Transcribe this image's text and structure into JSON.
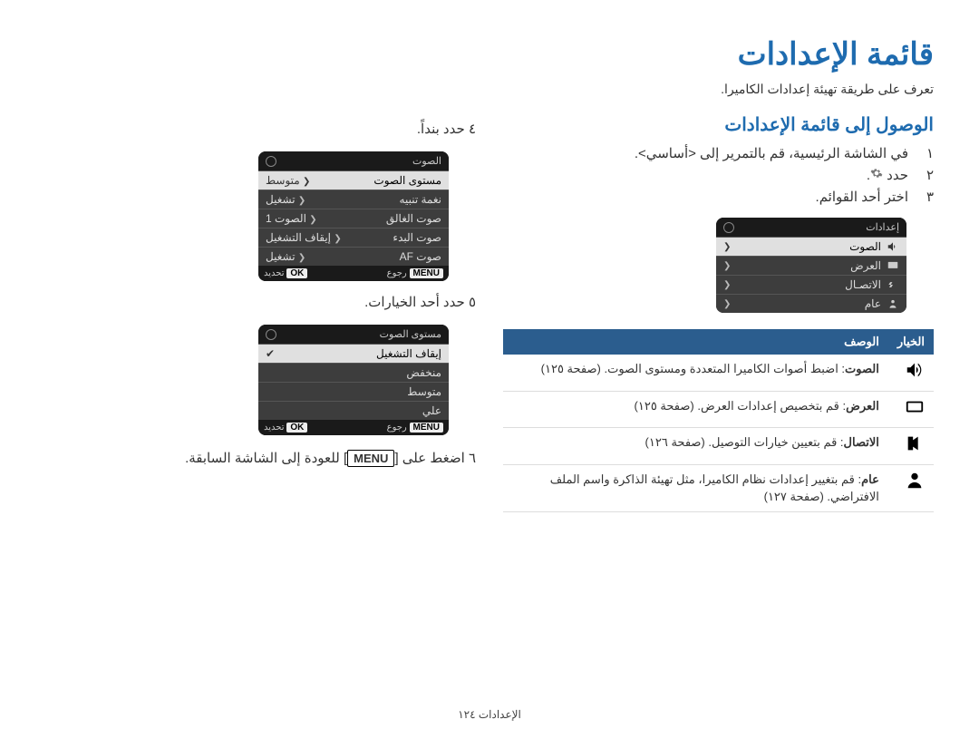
{
  "page_title": "قائمة الإعدادات",
  "subtitle": "تعرف على طريقة تهيئة إعدادات الكاميرا.",
  "section_heading": "الوصول إلى قائمة الإعدادات",
  "steps_right": {
    "s1": "١",
    "s1_text": "في الشاشة الرئيسية، قم بالتمرير إلى <أساسي>.",
    "s2": "٢",
    "s2_text": "حدد",
    "s3": "٣",
    "s3_text": "اختر أحد القوائم."
  },
  "cam1": {
    "header": "إعدادات",
    "row_sound": "الصوت",
    "row_display": "العرض",
    "row_conn": "الاتصـال",
    "row_general": "عام"
  },
  "option_table": {
    "header_option": "الخيار",
    "header_desc": "الوصف",
    "sound_label": "الصوت",
    "sound_desc": ": اضبط أصوات الكاميرا المتعددة ومستوى الصوت. (صفحة ١٢٥)",
    "display_label": "العرض",
    "display_desc": ": قم بتخصيص إعدادات العرض. (صفحة ١٢٥)",
    "conn_label": "الاتصال",
    "conn_desc": ": قم بتعيين خيارات التوصيل. (صفحة ١٢٦)",
    "general_label": "عام",
    "general_desc": ": قم بتغيير إعدادات نظام الكاميرا، مثل تهيئة الذاكرة واسم الملف الافتراضي. (صفحة ١٢٧)"
  },
  "steps_left": {
    "s4": "٤",
    "s4_text": "حدد بنداً.",
    "s5": "٥",
    "s5_text": "حدد أحد الخيارات.",
    "s6": "٦",
    "s6_text_before": "اضغط على [",
    "s6_menu": "MENU",
    "s6_text_after": "] للعودة إلى الشاشة السابقة."
  },
  "cam_sound": {
    "header": "الصوت",
    "vol_label": "مستوى الصوت",
    "vol_val": "متوسط",
    "beep_label": "نغمة تنبيه",
    "beep_val": "تشغيل",
    "shutter_label": "صوت الغالق",
    "shutter_val": "الصوت 1",
    "start_label": "صوت البدء",
    "start_val": "إيقاف التشغيل",
    "af_label": "صوت AF",
    "af_val": "تشغيل",
    "footer_back": "رجوع",
    "footer_set": "تحديد",
    "menu_key": "MENU",
    "ok_key": "OK"
  },
  "cam_volume": {
    "header": "مستوى الصوت",
    "off": "إيقاف التشغيل",
    "low": "منخفض",
    "medium": "متوسط",
    "high": "علي",
    "footer_back": "رجوع",
    "footer_set": "تحديد",
    "menu_key": "MENU",
    "ok_key": "OK"
  },
  "footer": "الإعدادات  ١٢٤"
}
